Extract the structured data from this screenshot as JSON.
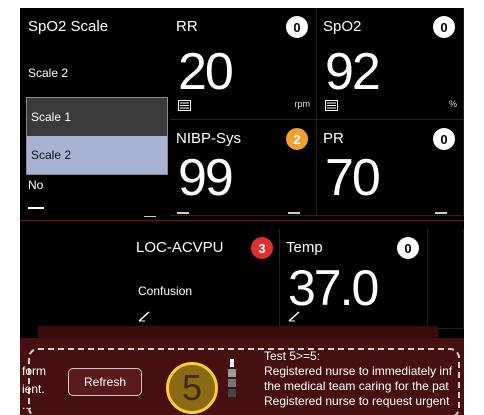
{
  "scale_panel": {
    "title": "SpO2 Scale",
    "current": "Scale 2",
    "options": [
      "Scale 1",
      "Scale 2"
    ],
    "selected": "Scale 2",
    "no_label": "No"
  },
  "tiles": {
    "rr": {
      "label": "RR",
      "value": "20",
      "unit": "rpm",
      "score": "0"
    },
    "spo2": {
      "label": "SpO2",
      "value": "92",
      "unit": "%",
      "score": "0"
    },
    "nibp": {
      "label": "NIBP-Sys",
      "value": "99",
      "score": "2"
    },
    "pr": {
      "label": "PR",
      "value": "70",
      "score": "0"
    },
    "loc": {
      "label": "LOC-ACVPU",
      "value": "Confusion",
      "score": "3"
    },
    "temp": {
      "label": "Temp",
      "value": "37.0",
      "score": "0"
    }
  },
  "banner": {
    "left_lines": [
      "form",
      "ient.",
      "..."
    ],
    "refresh_label": "Refresh",
    "total_score": "5",
    "messages": [
      "Test 5>=5:",
      "Registered nurse to immediately inf",
      "the medical team caring for the pat",
      "Registered nurse to request urgent"
    ]
  },
  "colors": {
    "score_white": "#ffffff",
    "score_orange": "#f0a030",
    "score_red": "#e03030",
    "selected_option": "#a6b3d3",
    "banner": "#471010",
    "total_circle": "#8b6a16"
  }
}
